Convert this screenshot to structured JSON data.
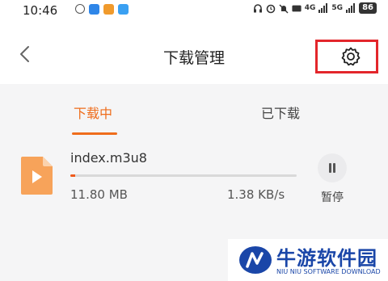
{
  "status_bar": {
    "time": "10:46",
    "net_label_1": "4G",
    "net_label_2": "5G",
    "battery": "86"
  },
  "header": {
    "title": "下载管理"
  },
  "tabs": [
    {
      "label": "下载中",
      "active": true
    },
    {
      "label": "已下载",
      "active": false
    }
  ],
  "download": {
    "file_name": "index.m3u8",
    "size": "11.80  MB",
    "speed": "1.38  KB/s",
    "progress_percent": 2,
    "pause_label": "暂停"
  },
  "watermark": {
    "title": "牛游软件园",
    "subtitle": "NIU NIU SOFTWARE DOWNLOAD"
  },
  "colors": {
    "accent": "#ef6d1c",
    "highlight_box": "#e3262b",
    "watermark": "#1a46a8"
  },
  "icons": [
    "back-icon",
    "settings-icon",
    "video-file-icon",
    "pause-icon"
  ]
}
